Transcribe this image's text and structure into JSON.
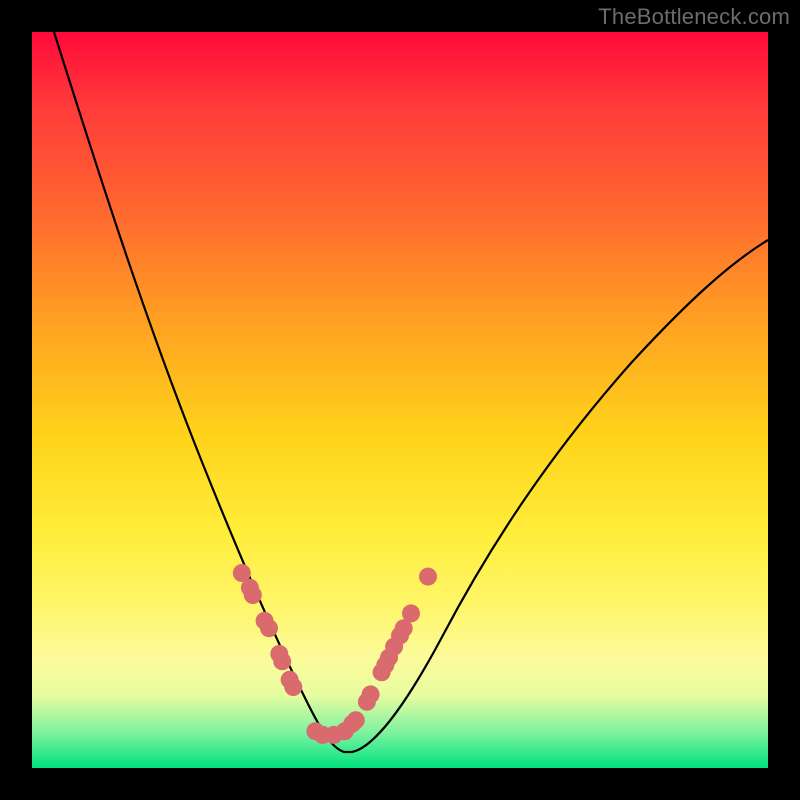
{
  "watermark": "TheBottleneck.com",
  "colors": {
    "background": "#000000",
    "curve": "#000000",
    "marker_fill": "#d96b6e",
    "marker_stroke": "#d96b6e"
  },
  "chart_data": {
    "type": "line",
    "title": "",
    "xlabel": "",
    "ylabel": "",
    "xlim": [
      0,
      100
    ],
    "ylim": [
      0,
      100
    ],
    "series": [
      {
        "name": "bottleneck-curve",
        "x": [
          3,
          6,
          10,
          14,
          18,
          22,
          25,
          27,
          29,
          31,
          33,
          35,
          37,
          38.5,
          40,
          41.5,
          43,
          45,
          48,
          52,
          56,
          60,
          65,
          70,
          76,
          84,
          92,
          100
        ],
        "values": [
          100,
          88,
          75,
          63,
          52,
          42,
          34,
          29,
          24,
          19,
          14,
          9,
          5,
          2.5,
          1,
          1,
          2,
          5,
          10,
          18,
          25,
          32,
          39,
          46,
          52,
          59,
          65,
          70
        ]
      }
    ],
    "markers": {
      "name": "highlighted-points",
      "x_pct": [
        28.5,
        29.6,
        30.0,
        31.6,
        32.2,
        33.6,
        34.0,
        35.0,
        35.5,
        38.5,
        39.5,
        41.0,
        42.5,
        43.5,
        44.0,
        45.5,
        46.0,
        47.5,
        48.0,
        48.5,
        49.2,
        50.0,
        50.5,
        51.5,
        53.8
      ],
      "y_pct": [
        73.5,
        75.5,
        76.5,
        80.0,
        81.0,
        84.5,
        85.5,
        88.0,
        89.0,
        95.0,
        95.5,
        95.5,
        95.0,
        94.0,
        93.5,
        91.0,
        90.0,
        87.0,
        86.0,
        85.0,
        83.5,
        82.0,
        81.0,
        79.0,
        74.0
      ]
    }
  }
}
